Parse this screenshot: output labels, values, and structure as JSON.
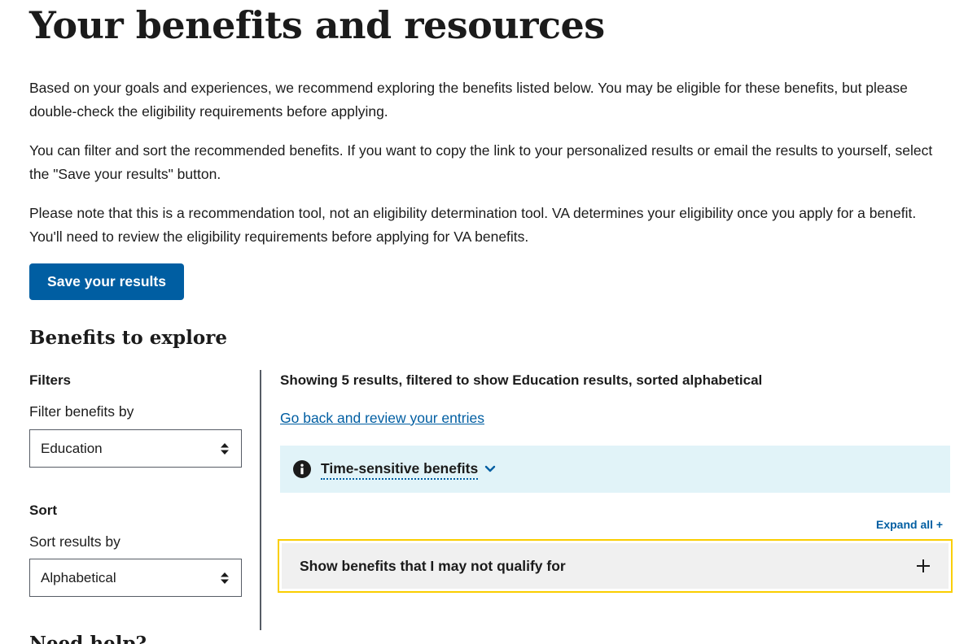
{
  "page": {
    "title": "Your benefits and resources",
    "intro_paragraphs": [
      "Based on your goals and experiences, we recommend exploring the benefits listed below. You may be eligible for these benefits, but please double-check the eligibility requirements before applying.",
      "You can filter and sort the recommended benefits. If you want to copy the link to your personalized results or email the results to yourself, select the \"Save your results\" button.",
      "Please note that this is a recommendation tool, not an eligibility determination tool. VA determines your eligibility once you apply for a benefit. You'll need to review the eligibility requirements before applying for VA benefits."
    ],
    "save_button_label": "Save your results",
    "section_heading": "Benefits to explore",
    "next_heading_partial": "Need help?"
  },
  "filters": {
    "title": "Filters",
    "filter_label": "Filter benefits by",
    "filter_value": "Education",
    "sort_title": "Sort",
    "sort_label": "Sort results by",
    "sort_value": "Alphabetical"
  },
  "results": {
    "summary": "Showing 5 results, filtered to show Education results, sorted alphabetical",
    "back_link": "Go back and review your entries",
    "alert_toggle_label": "Time-sensitive benefits",
    "expand_all_label": "Expand all +",
    "accordion_label": "Show benefits that I may not qualify for"
  },
  "icons": {
    "info": "info-icon",
    "chevron": "chevron-down-icon",
    "select_arrows": "sort-arrows-icon",
    "plus": "plus-icon"
  },
  "colors": {
    "primary": "#005ea2",
    "alert_bg": "#e1f3f8",
    "focus_outline": "#face00",
    "accordion_bg": "#f0f0f0",
    "text": "#1b1b1b"
  }
}
